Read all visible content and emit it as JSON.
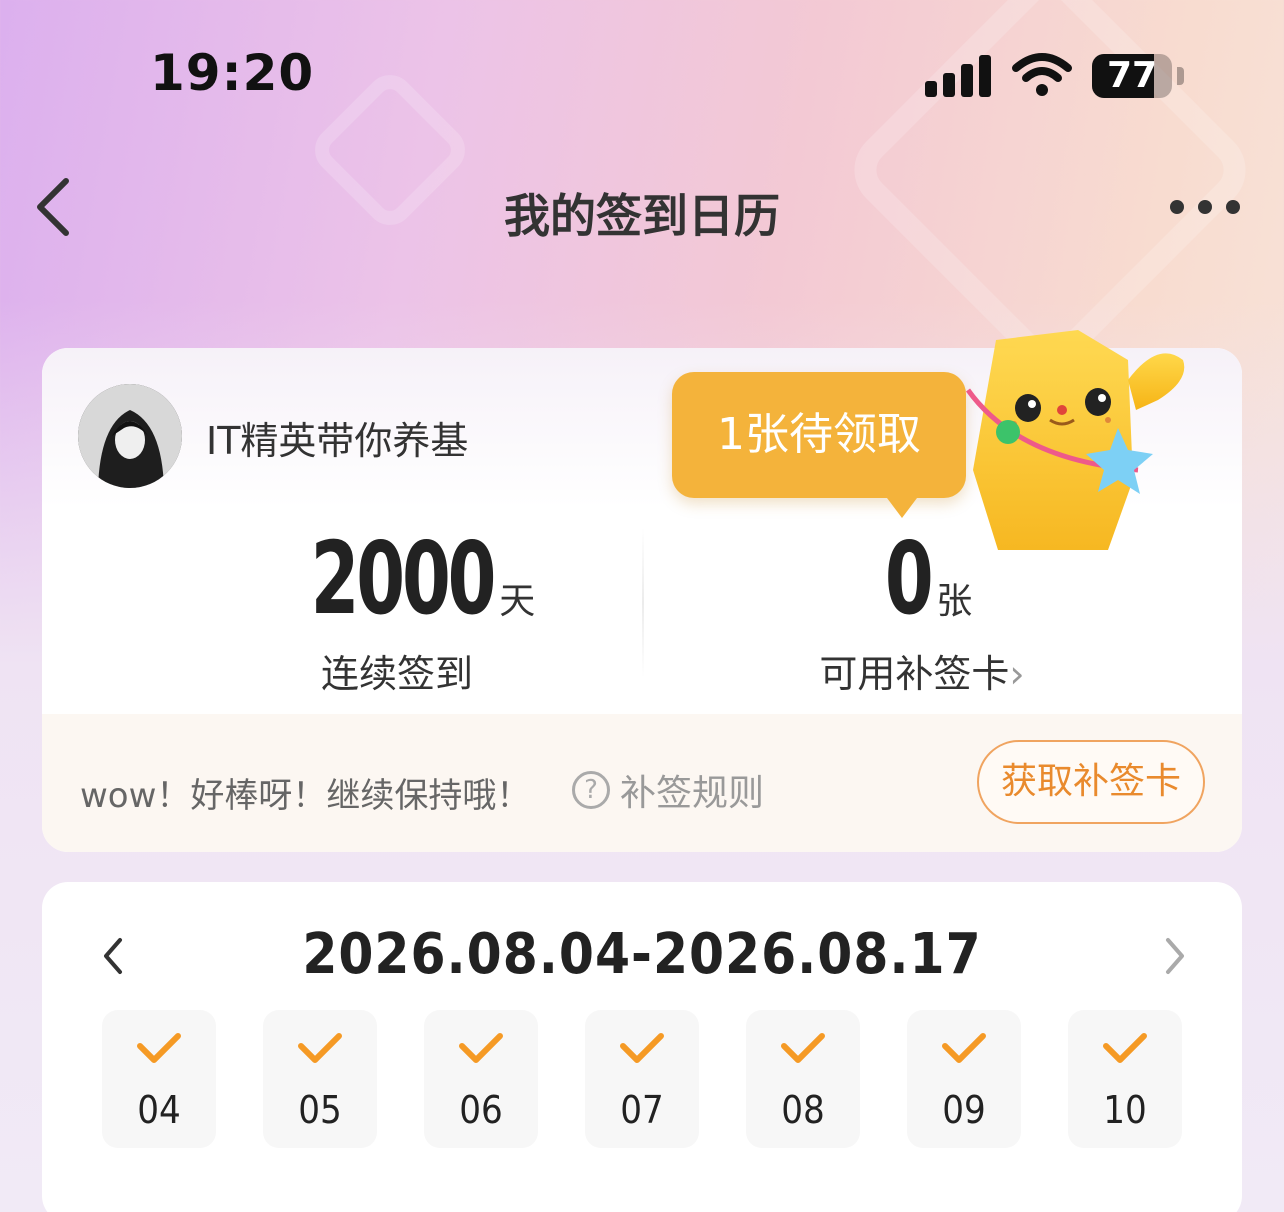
{
  "status_bar": {
    "time": "19:20",
    "battery": "77",
    "battery_level": 0.77
  },
  "nav": {
    "title": "我的签到日历",
    "back_icon": "chevron-left-icon",
    "more_icon": "more-horizontal-icon"
  },
  "profile": {
    "username": "IT精英带你养基"
  },
  "stats": {
    "streak_value": "2000",
    "streak_unit": "天",
    "streak_label": "连续签到",
    "cards_value": "0",
    "cards_unit": "张",
    "cards_label": "可用补签卡",
    "cards_chevron": "›"
  },
  "tooltip": {
    "text": "1张待领取"
  },
  "footer": {
    "encourage": "wow！好棒呀！继续保持哦！",
    "rules_label": "补签规则",
    "rules_icon": "?",
    "get_card_button": "获取补签卡"
  },
  "calendar": {
    "range": "2026.08.04-2026.08.17",
    "days": [
      {
        "day": "04",
        "checked": true
      },
      {
        "day": "05",
        "checked": true
      },
      {
        "day": "06",
        "checked": true
      },
      {
        "day": "07",
        "checked": true
      },
      {
        "day": "08",
        "checked": true
      },
      {
        "day": "09",
        "checked": true
      },
      {
        "day": "10",
        "checked": true
      }
    ]
  },
  "colors": {
    "accent_orange": "#f4b33b",
    "check_orange": "#f59a25",
    "button_border": "#f0a460"
  }
}
